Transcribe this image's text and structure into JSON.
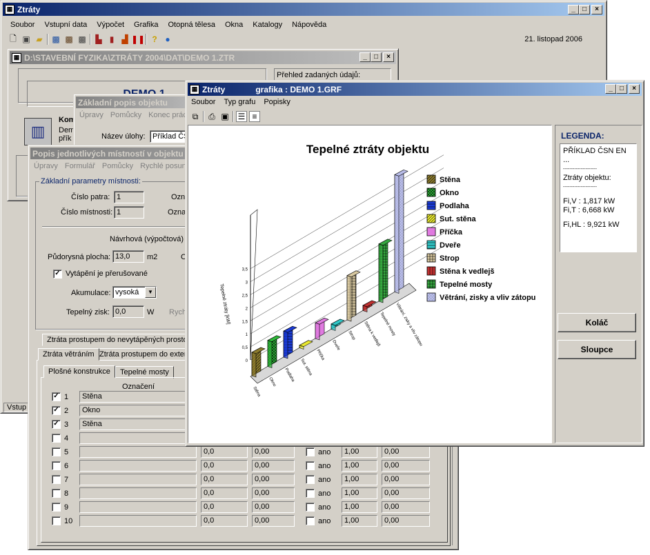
{
  "main": {
    "title": "Ztráty",
    "menu": [
      "Soubor",
      "Vstupní data",
      "Výpočet",
      "Grafika",
      "Otopná tělesa",
      "Okna",
      "Katalogy",
      "Nápověda"
    ],
    "date": "21. listopad 2006",
    "status": "Vstup"
  },
  "doc": {
    "title": "D:\\STAVEBNÍ FYZIKA\\ZTRÁTY 2004\\DAT\\DEMO 1.ZTR",
    "project": "DEMO 1",
    "overview": "Přehled zadaných údajů:",
    "kom": "Kom",
    "dem": "Dem",
    "pri": "přík"
  },
  "basic": {
    "title": "Základní popis objektu",
    "menu": [
      "Úpravy",
      "Pomůcky",
      "Konec prác"
    ],
    "task_label": "Název úlohy:",
    "task_value": "Příklad ČSN"
  },
  "rooms": {
    "title": "Popis jednotlivých místností v objektu",
    "menu": [
      "Úpravy",
      "Formulář",
      "Pomůcky",
      "Rychlé posun"
    ],
    "group": "Základní parametry místnosti:",
    "floor_label": "Číslo patra:",
    "floor": "1",
    "room_label": "Číslo místnosti:",
    "room": "1",
    "ozn1": "Ozn",
    "ozn2": "Ozna",
    "design": "Návrhová (výpočtová)",
    "area_label": "Půdorysná plocha:",
    "area": "13,0",
    "area_unit": "m2",
    "o_cut": "O",
    "heat_label": "Vytápění je přerušované",
    "acc_label": "Akumulace:",
    "acc": "vysoká",
    "gain_label": "Tepelný zisk:",
    "gain": "0,0",
    "gain_unit": "W",
    "rych": "Rych",
    "tabs_top": [
      "Ztráta prostupem do nevytápěných prosto"
    ],
    "tabs_mid": [
      "Ztráta větráním",
      "Ztráta prostupem do exter"
    ],
    "tabs_low": [
      "Plošné konstrukce",
      "Tepelné mosty"
    ],
    "col_header": "Označení",
    "rows": [
      {
        "n": "1",
        "name": "Stěna",
        "checked": "✓"
      },
      {
        "n": "2",
        "name": "Okno",
        "checked": "✓"
      },
      {
        "n": "3",
        "name": "Stěna",
        "checked": "✓"
      },
      {
        "n": "4",
        "name": "",
        "checked": ""
      },
      {
        "n": "5",
        "name": "",
        "checked": ""
      },
      {
        "n": "6",
        "name": "",
        "checked": ""
      },
      {
        "n": "7",
        "name": "",
        "checked": ""
      },
      {
        "n": "8",
        "name": "",
        "checked": ""
      },
      {
        "n": "9",
        "name": "",
        "checked": ""
      },
      {
        "n": "10",
        "name": "",
        "checked": ""
      }
    ],
    "row_vals": {
      "a": "0,0",
      "b": "0,00",
      "ano": "ano",
      "c": "1,00",
      "d": "0,00"
    }
  },
  "graph": {
    "title_left": "Ztráty",
    "title_right": "grafika : DEMO 1.GRF",
    "menu": [
      "Soubor",
      "Typ grafu",
      "Popisky"
    ],
    "legend_title": "LEGENDA:",
    "legend_lines": [
      "PŘÍKLAD ČSN EN ...",
      "---------------------",
      "Ztráty objektu:",
      "---------------------",
      "Fi,V : 1,817 kW",
      "Fi,T : 6,668 kW",
      "Fi,HL : 9,921 kW"
    ],
    "btn_pie": "Koláč",
    "btn_bars": "Sloupce"
  },
  "chart_data": {
    "type": "bar",
    "title": "Tepelné ztráty objektu",
    "ylabel": "Tepelné ztráty [kW]",
    "ylim": [
      0,
      5
    ],
    "categories": [
      "Stěna",
      "Okno",
      "Podlaha",
      "Sut. stěna",
      "Příčka",
      "Dveře",
      "Strop",
      "Stěna k vedlejš",
      "Tepelné mosty",
      "Větrání, zisky a vliv zátopu"
    ],
    "values": [
      0.9,
      1.0,
      1.0,
      0.1,
      0.6,
      0.2,
      1.7,
      0.2,
      2.2,
      4.5
    ],
    "colors": [
      "#8b7b2e",
      "#2fb83a",
      "#1b3bd6",
      "#e8e830",
      "#e07ae0",
      "#30c8c8",
      "#d8c8a0",
      "#c03030",
      "#36a840",
      "#b8bce8"
    ]
  }
}
